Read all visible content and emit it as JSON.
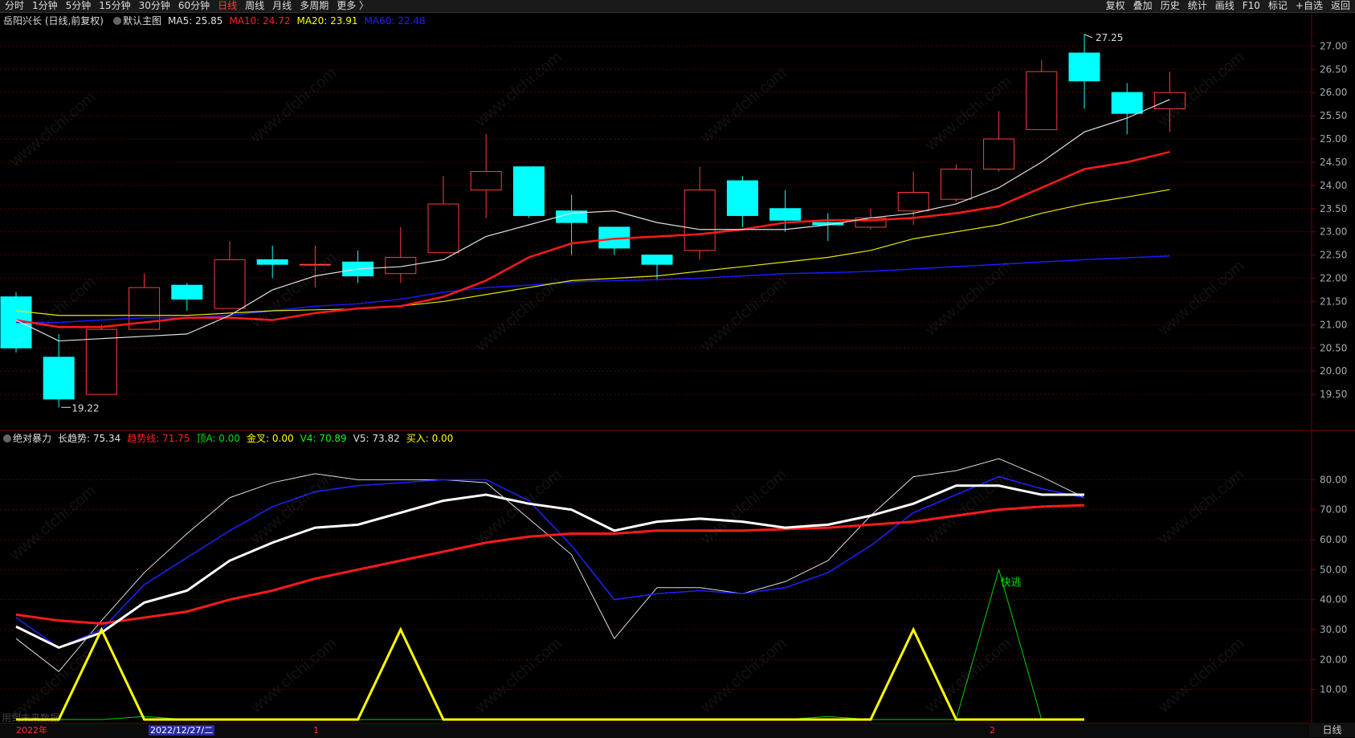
{
  "topbar": {
    "periods": [
      "分时",
      "1分钟",
      "5分钟",
      "15分钟",
      "30分钟",
      "60分钟",
      "日线",
      "周线",
      "月线",
      "多周期",
      "更多 〉"
    ],
    "active_period": "日线",
    "tools": [
      "复权",
      "叠加",
      "历史",
      "统计",
      "画线",
      "F10",
      "标记",
      "+自选",
      "返回"
    ]
  },
  "main": {
    "stock_title": "岳阳兴长 (日线,前复权)",
    "chart_name": "默认主图",
    "ma": [
      {
        "label": "MA5:",
        "value": "25.85",
        "color": "#e0e0e0"
      },
      {
        "label": "MA10:",
        "value": "24.72",
        "color": "#ff2020"
      },
      {
        "label": "MA20:",
        "value": "23.91",
        "color": "#ffff00"
      },
      {
        "label": "MA60:",
        "value": "22.48",
        "color": "#2020ff"
      }
    ],
    "high_label": "27.25",
    "low_label": "19.22"
  },
  "indicator": {
    "name": "绝对暴力",
    "items": [
      {
        "label": "长趋势:",
        "value": "75.34",
        "color": "#e0e0e0"
      },
      {
        "label": "趋势线:",
        "value": "71.75",
        "color": "#ff2020"
      },
      {
        "label": "顶A:",
        "value": "0.00",
        "color": "#00e000"
      },
      {
        "label": "金叉:",
        "value": "0.00",
        "color": "#ffff00"
      },
      {
        "label": "V4:",
        "value": "70.89",
        "color": "#00ff00"
      },
      {
        "label": "V5:",
        "value": "73.82",
        "color": "#e0e0e0"
      },
      {
        "label": "买入:",
        "value": "0.00",
        "color": "#ffff00"
      }
    ],
    "signal_text": "快逃"
  },
  "bottom": {
    "year": "2022年",
    "cursor_date": "2022/12/27/二",
    "month1": "1",
    "month2": "2",
    "right_tab": "日线",
    "ghost_text": "用到未来数据"
  },
  "watermark": "www.cfchi.com",
  "chart_data": [
    {
      "type": "candlestick",
      "title": "岳阳兴长 (日线,前复权)",
      "ylim": [
        19.0,
        27.3
      ],
      "yticks": [
        19.5,
        20.0,
        20.5,
        21.0,
        21.5,
        22.0,
        22.5,
        23.0,
        23.5,
        24.0,
        24.5,
        25.0,
        25.5,
        26.0,
        26.5,
        27.0
      ],
      "candles": [
        {
          "o": 21.6,
          "h": 21.7,
          "l": 20.4,
          "c": 20.5
        },
        {
          "o": 20.3,
          "h": 20.8,
          "l": 19.22,
          "c": 19.4
        },
        {
          "o": 19.5,
          "h": 21.0,
          "l": 19.5,
          "c": 20.9
        },
        {
          "o": 20.9,
          "h": 22.1,
          "l": 20.9,
          "c": 21.8
        },
        {
          "o": 21.85,
          "h": 21.9,
          "l": 21.3,
          "c": 21.55
        },
        {
          "o": 21.35,
          "h": 22.8,
          "l": 21.35,
          "c": 22.4
        },
        {
          "o": 22.4,
          "h": 22.7,
          "l": 22.0,
          "c": 22.3
        },
        {
          "o": 22.3,
          "h": 22.7,
          "l": 21.8,
          "c": 22.3
        },
        {
          "o": 22.35,
          "h": 22.6,
          "l": 21.9,
          "c": 22.05
        },
        {
          "o": 22.1,
          "h": 23.1,
          "l": 21.9,
          "c": 22.45
        },
        {
          "o": 22.55,
          "h": 24.2,
          "l": 22.55,
          "c": 23.6
        },
        {
          "o": 23.9,
          "h": 25.1,
          "l": 23.3,
          "c": 24.3
        },
        {
          "o": 24.4,
          "h": 24.4,
          "l": 23.3,
          "c": 23.35
        },
        {
          "o": 23.45,
          "h": 23.8,
          "l": 22.5,
          "c": 23.2
        },
        {
          "o": 23.1,
          "h": 23.1,
          "l": 22.5,
          "c": 22.65
        },
        {
          "o": 22.5,
          "h": 22.5,
          "l": 21.95,
          "c": 22.3
        },
        {
          "o": 22.6,
          "h": 24.4,
          "l": 22.4,
          "c": 23.9
        },
        {
          "o": 24.1,
          "h": 24.2,
          "l": 23.1,
          "c": 23.35
        },
        {
          "o": 23.5,
          "h": 23.9,
          "l": 23.0,
          "c": 23.25
        },
        {
          "o": 23.2,
          "h": 23.4,
          "l": 22.8,
          "c": 23.15
        },
        {
          "o": 23.1,
          "h": 23.5,
          "l": 23.05,
          "c": 23.3
        },
        {
          "o": 23.45,
          "h": 24.3,
          "l": 23.15,
          "c": 23.85
        },
        {
          "o": 23.7,
          "h": 24.45,
          "l": 23.65,
          "c": 24.35
        },
        {
          "o": 24.35,
          "h": 25.6,
          "l": 24.3,
          "c": 25.0
        },
        {
          "o": 25.2,
          "h": 26.7,
          "l": 25.2,
          "c": 26.45
        },
        {
          "o": 26.85,
          "h": 27.25,
          "l": 25.65,
          "c": 26.25
        },
        {
          "o": 26.0,
          "h": 26.2,
          "l": 25.1,
          "c": 25.55
        },
        {
          "o": 25.65,
          "h": 26.45,
          "l": 25.15,
          "c": 26.0
        }
      ],
      "ma5": [
        21.1,
        20.65,
        20.7,
        20.75,
        20.8,
        21.2,
        21.75,
        22.05,
        22.2,
        22.25,
        22.4,
        22.9,
        23.15,
        23.4,
        23.45,
        23.2,
        23.05,
        23.05,
        23.05,
        23.15,
        23.3,
        23.4,
        23.6,
        23.95,
        24.5,
        25.15,
        25.45,
        25.85
      ],
      "ma10": [
        21.1,
        20.95,
        20.95,
        21.05,
        21.15,
        21.15,
        21.1,
        21.25,
        21.35,
        21.4,
        21.6,
        21.95,
        22.45,
        22.75,
        22.85,
        22.9,
        22.95,
        23.05,
        23.2,
        23.25,
        23.25,
        23.3,
        23.4,
        23.55,
        23.95,
        24.35,
        24.5,
        24.72
      ],
      "ma20": [
        21.3,
        21.2,
        21.2,
        21.2,
        21.2,
        21.25,
        21.3,
        21.32,
        21.34,
        21.4,
        21.5,
        21.65,
        21.8,
        21.95,
        22.0,
        22.05,
        22.15,
        22.25,
        22.35,
        22.45,
        22.6,
        22.85,
        23.0,
        23.15,
        23.4,
        23.6,
        23.75,
        23.91
      ],
      "ma60": [
        21.05,
        21.05,
        21.1,
        21.15,
        21.15,
        21.2,
        21.3,
        21.4,
        21.45,
        21.55,
        21.7,
        21.8,
        21.85,
        21.92,
        21.95,
        21.97,
        22.0,
        22.05,
        22.1,
        22.12,
        22.15,
        22.2,
        22.25,
        22.3,
        22.35,
        22.4,
        22.44,
        22.48
      ]
    },
    {
      "type": "line",
      "title": "绝对暴力",
      "ylim": [
        0,
        90
      ],
      "yticks": [
        10,
        20,
        30,
        40,
        50,
        60,
        70,
        80
      ],
      "series": [
        {
          "name": "长趋势",
          "color": "#ffffff",
          "width": 3,
          "values": [
            31,
            24,
            29,
            39,
            43,
            53,
            59,
            64,
            65,
            69,
            73,
            75,
            72,
            70,
            63,
            66,
            67,
            66,
            64,
            65,
            68,
            72,
            78,
            78,
            75,
            75
          ]
        },
        {
          "name": "趋势线",
          "color": "#ff1a1a",
          "width": 3,
          "values": [
            35,
            33,
            32,
            34,
            36,
            40,
            43,
            47,
            50,
            53,
            56,
            59,
            61,
            62,
            62,
            63,
            63,
            63,
            63.5,
            64,
            65,
            66,
            68,
            70,
            71,
            71.5
          ]
        },
        {
          "name": "V4",
          "color": "#2020ff",
          "width": 1.5,
          "values": [
            34,
            24,
            30,
            45,
            54,
            63,
            71,
            76,
            78,
            79,
            80,
            80,
            73,
            58,
            40,
            42,
            43,
            42,
            44,
            49,
            58,
            69,
            75,
            81,
            77,
            74
          ]
        },
        {
          "name": "V5",
          "color": "#dddddd",
          "width": 1,
          "values": [
            27,
            16,
            33,
            49,
            62,
            74,
            79,
            82,
            80,
            80,
            80,
            79,
            67,
            55,
            27,
            44,
            44,
            42,
            46,
            53,
            68,
            81,
            83,
            87,
            81,
            74
          ]
        },
        {
          "name": "金叉",
          "color": "#ffff00",
          "width": 3,
          "values": [
            0,
            0,
            30,
            0,
            0,
            0,
            0,
            0,
            0,
            30,
            0,
            0,
            0,
            0,
            0,
            0,
            0,
            0,
            0,
            0,
            0,
            30,
            0,
            0,
            0,
            0
          ]
        },
        {
          "name": "顶A",
          "color": "#00d000",
          "width": 1,
          "values": [
            0,
            0,
            0,
            1,
            0,
            0,
            0,
            0,
            0,
            0,
            0,
            0,
            0,
            0,
            0,
            0,
            0,
            0,
            0,
            1,
            0,
            0,
            0,
            50,
            0,
            0
          ]
        }
      ]
    }
  ]
}
